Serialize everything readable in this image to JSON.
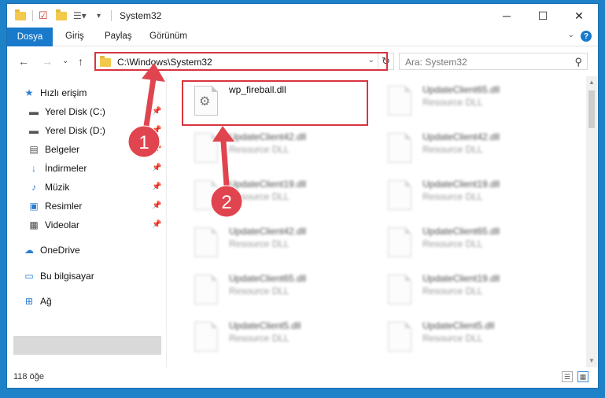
{
  "window": {
    "title": "System32",
    "minimize": "─",
    "maximize": "☐",
    "close": "✕"
  },
  "ribbon": {
    "tabs": [
      "Dosya",
      "Giriş",
      "Paylaş",
      "Görünüm"
    ],
    "help": "?"
  },
  "nav": {
    "back": "←",
    "forward": "→",
    "recent": "⌄",
    "up": "↑",
    "address": "C:\\Windows\\System32",
    "refresh": "↻",
    "search_placeholder": "Ara: System32"
  },
  "sidebar": {
    "quick_access": "Hızlı erişim",
    "items": [
      {
        "label": "Yerel Disk (C:)",
        "icon": "drive-icon",
        "pinned": true
      },
      {
        "label": "Yerel Disk (D:)",
        "icon": "drive-icon",
        "pinned": true
      },
      {
        "label": "Belgeler",
        "icon": "documents-icon",
        "pinned": true
      },
      {
        "label": "İndirmeler",
        "icon": "download-icon",
        "pinned": true
      },
      {
        "label": "Müzik",
        "icon": "music-icon",
        "pinned": true
      },
      {
        "label": "Resimler",
        "icon": "pictures-icon",
        "pinned": true
      },
      {
        "label": "Videolar",
        "icon": "videos-icon",
        "pinned": true
      }
    ],
    "onedrive": "OneDrive",
    "this_pc": "Bu bilgisayar",
    "network": "Ağ"
  },
  "files": [
    {
      "name": "wp_fireball.dll",
      "type": ""
    },
    {
      "name": "UpdateClient65.dll",
      "type": "Resource DLL"
    },
    {
      "name": "UpdateClient42.dll",
      "type": "Resource DLL"
    },
    {
      "name": "UpdateClient42.dll",
      "type": "Resource DLL"
    },
    {
      "name": "UpdateClient19.dll",
      "type": "Resource DLL"
    },
    {
      "name": "UpdateClient19.dll",
      "type": "Resource DLL"
    },
    {
      "name": "UpdateClient42.dll",
      "type": "Resource DLL"
    },
    {
      "name": "UpdateClient65.dll",
      "type": "Resource DLL"
    },
    {
      "name": "UpdateClient65.dll",
      "type": "Resource DLL"
    },
    {
      "name": "UpdateClient19.dll",
      "type": "Resource DLL"
    },
    {
      "name": "UpdateClient5.dll",
      "type": "Resource DLL"
    },
    {
      "name": "UpdateClient5.dll",
      "type": "Resource DLL"
    }
  ],
  "status": {
    "count": "118 öğe"
  },
  "annotations": {
    "marker1": "1",
    "marker2": "2",
    "color": "#e0454f"
  }
}
